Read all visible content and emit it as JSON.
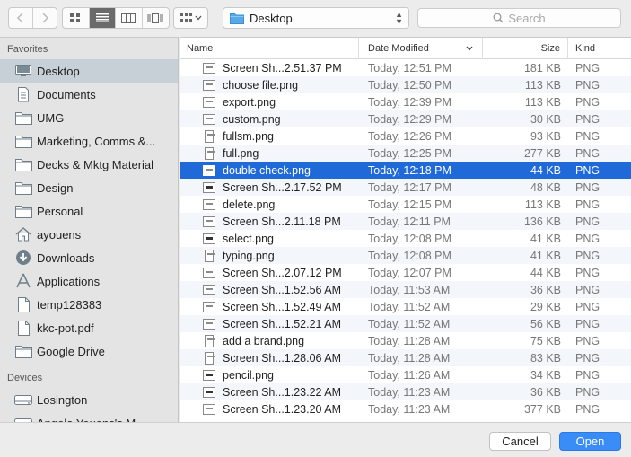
{
  "toolbar": {
    "back_icon": "chevron-left-icon",
    "forward_icon": "chevron-right-icon",
    "view_modes": [
      "icon-view",
      "list-view",
      "column-view",
      "cover-flow-view"
    ],
    "active_view": "list-view",
    "path_label": "Desktop",
    "search_placeholder": "Search"
  },
  "sidebar": {
    "favorites_header": "Favorites",
    "favorites": [
      {
        "label": "Desktop",
        "icon": "desktop-icon",
        "active": true
      },
      {
        "label": "Documents",
        "icon": "documents-icon"
      },
      {
        "label": "UMG",
        "icon": "folder-icon"
      },
      {
        "label": "Marketing, Comms &...",
        "icon": "folder-icon"
      },
      {
        "label": "Decks & Mktg Material",
        "icon": "folder-icon"
      },
      {
        "label": "Design",
        "icon": "folder-icon"
      },
      {
        "label": "Personal",
        "icon": "folder-icon"
      },
      {
        "label": "ayouens",
        "icon": "home-icon"
      },
      {
        "label": "Downloads",
        "icon": "downloads-icon"
      },
      {
        "label": "Applications",
        "icon": "applications-icon"
      },
      {
        "label": "temp128383",
        "icon": "file-icon"
      },
      {
        "label": "kkc-pot.pdf",
        "icon": "file-icon"
      },
      {
        "label": "Google Drive",
        "icon": "folder-icon"
      }
    ],
    "devices_header": "Devices",
    "devices": [
      {
        "label": "Losington",
        "icon": "hard-drive-icon"
      },
      {
        "label": "Angela Youens's M...",
        "icon": "hard-drive-icon"
      }
    ]
  },
  "list": {
    "columns": {
      "name": "Name",
      "date": "Date Modified",
      "size": "Size",
      "kind": "Kind"
    },
    "rows": [
      {
        "name": "Screen Sh...2.51.37 PM",
        "date": "Today, 12:51 PM",
        "size": "181 KB",
        "kind": "PNG",
        "thumb": "wide"
      },
      {
        "name": "choose file.png",
        "date": "Today, 12:50 PM",
        "size": "113 KB",
        "kind": "PNG",
        "thumb": "wide"
      },
      {
        "name": "export.png",
        "date": "Today, 12:39 PM",
        "size": "113 KB",
        "kind": "PNG",
        "thumb": "wide"
      },
      {
        "name": "custom.png",
        "date": "Today, 12:29 PM",
        "size": "30 KB",
        "kind": "PNG",
        "thumb": "wide"
      },
      {
        "name": "fullsm.png",
        "date": "Today, 12:26 PM",
        "size": "93 KB",
        "kind": "PNG",
        "thumb": "tall"
      },
      {
        "name": "full.png",
        "date": "Today, 12:25 PM",
        "size": "277 KB",
        "kind": "PNG",
        "thumb": "tall"
      },
      {
        "name": "double check.png",
        "date": "Today, 12:18 PM",
        "size": "44 KB",
        "kind": "PNG",
        "thumb": "wide",
        "selected": true
      },
      {
        "name": "Screen Sh...2.17.52 PM",
        "date": "Today, 12:17 PM",
        "size": "48 KB",
        "kind": "PNG",
        "thumb": "dark"
      },
      {
        "name": "delete.png",
        "date": "Today, 12:15 PM",
        "size": "113 KB",
        "kind": "PNG",
        "thumb": "wide"
      },
      {
        "name": "Screen Sh...2.11.18 PM",
        "date": "Today, 12:11 PM",
        "size": "136 KB",
        "kind": "PNG",
        "thumb": "wide"
      },
      {
        "name": "select.png",
        "date": "Today, 12:08 PM",
        "size": "41 KB",
        "kind": "PNG",
        "thumb": "dark"
      },
      {
        "name": "typing.png",
        "date": "Today, 12:08 PM",
        "size": "41 KB",
        "kind": "PNG",
        "thumb": "tall"
      },
      {
        "name": "Screen Sh...2.07.12 PM",
        "date": "Today, 12:07 PM",
        "size": "44 KB",
        "kind": "PNG",
        "thumb": "wide"
      },
      {
        "name": "Screen Sh...1.52.56 AM",
        "date": "Today, 11:53 AM",
        "size": "36 KB",
        "kind": "PNG",
        "thumb": "wide"
      },
      {
        "name": "Screen Sh...1.52.49 AM",
        "date": "Today, 11:52 AM",
        "size": "29 KB",
        "kind": "PNG",
        "thumb": "wide"
      },
      {
        "name": "Screen Sh...1.52.21 AM",
        "date": "Today, 11:52 AM",
        "size": "56 KB",
        "kind": "PNG",
        "thumb": "wide"
      },
      {
        "name": "add a brand.png",
        "date": "Today, 11:28 AM",
        "size": "75 KB",
        "kind": "PNG",
        "thumb": "tall"
      },
      {
        "name": "Screen Sh...1.28.06 AM",
        "date": "Today, 11:28 AM",
        "size": "83 KB",
        "kind": "PNG",
        "thumb": "tall"
      },
      {
        "name": "pencil.png",
        "date": "Today, 11:26 AM",
        "size": "34 KB",
        "kind": "PNG",
        "thumb": "dark"
      },
      {
        "name": "Screen Sh...1.23.22 AM",
        "date": "Today, 11:23 AM",
        "size": "36 KB",
        "kind": "PNG",
        "thumb": "dark"
      },
      {
        "name": "Screen Sh...1.23.20 AM",
        "date": "Today, 11:23 AM",
        "size": "377 KB",
        "kind": "PNG",
        "thumb": "wide"
      }
    ]
  },
  "footer": {
    "cancel_label": "Cancel",
    "open_label": "Open"
  },
  "colors": {
    "selection": "#1f69d8",
    "sidebar_active": "#c6d0d6",
    "open_button": "#3a8cf7",
    "folder": "#58a9e8"
  }
}
